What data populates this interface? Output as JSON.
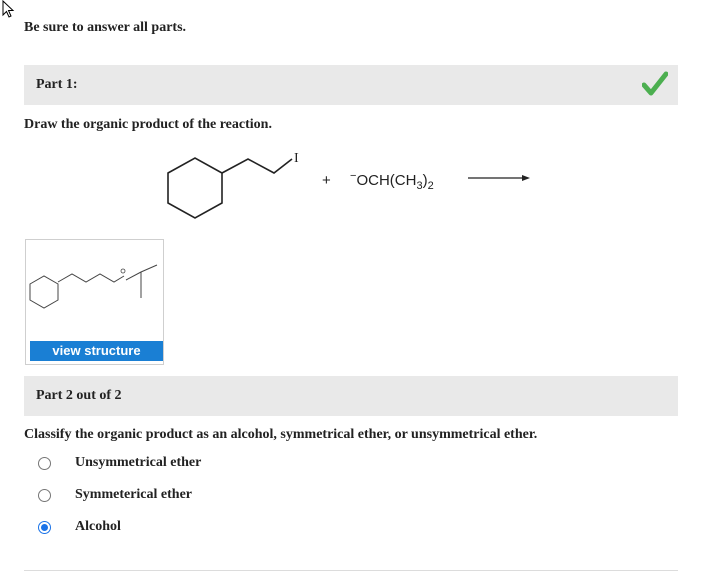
{
  "intro": "Be sure to answer all parts.",
  "part1": {
    "label": "Part 1:",
    "status_icon": "checkmark-icon",
    "status_color": "#4caf50",
    "prompt": "Draw the organic product of the reaction.",
    "reaction": {
      "leaving_group": "I",
      "plus": "+",
      "reagent": "−OCH(CH3)2"
    },
    "view_button_label": "view structure"
  },
  "part2": {
    "label": "Part 2 out of 2",
    "question": "Classify the organic product as an alcohol, symmetrical ether, or unsymmetrical ether.",
    "options": [
      {
        "label": "Unsymmetrical ether",
        "selected": false
      },
      {
        "label": "Symmeterical ether",
        "selected": false
      },
      {
        "label": "Alcohol",
        "selected": true
      }
    ]
  },
  "colors": {
    "accent": "#1a7fd4",
    "bar_bg": "#e9e9e9"
  }
}
